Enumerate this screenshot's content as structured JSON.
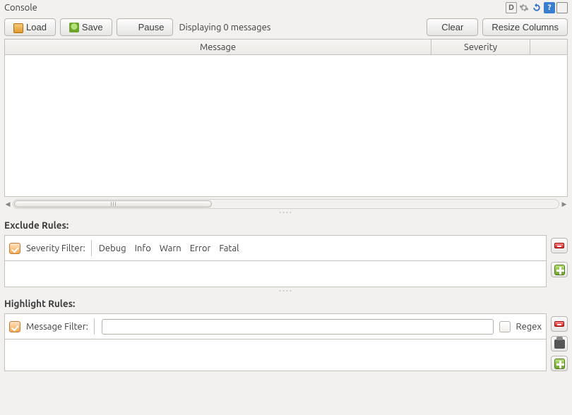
{
  "title": "Console",
  "toolbar": {
    "load": "Load",
    "save": "Save",
    "pause": "Pause",
    "status": "Displaying 0 messages",
    "clear": "Clear",
    "resize": "Resize Columns"
  },
  "table": {
    "headers": {
      "message": "Message",
      "severity": "Severity"
    }
  },
  "exclude": {
    "label": "Exclude Rules:",
    "filter_label": "Severity Filter:",
    "severities": [
      "Debug",
      "Info",
      "Warn",
      "Error",
      "Fatal"
    ]
  },
  "highlight": {
    "label": "Highlight Rules:",
    "filter_label": "Message Filter:",
    "regex_label": "Regex",
    "input_value": ""
  }
}
